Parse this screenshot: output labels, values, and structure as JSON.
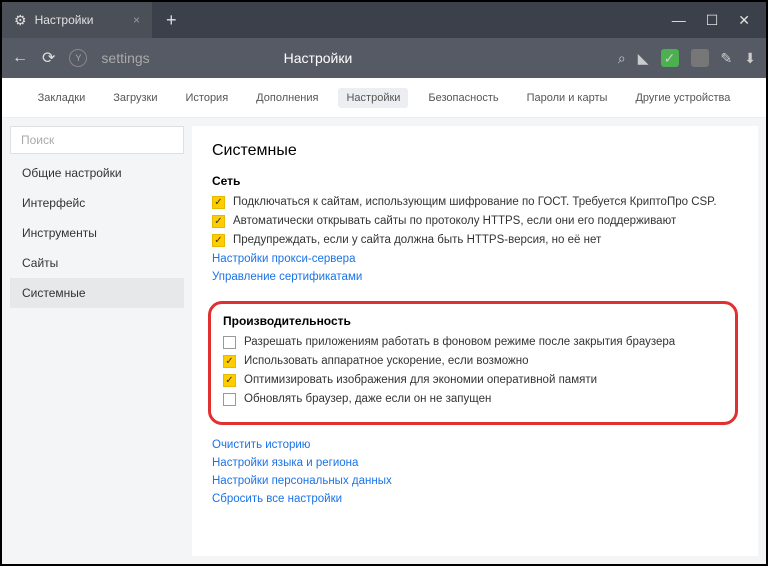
{
  "window": {
    "min": "—",
    "max": "☐",
    "close": "✕"
  },
  "tab": {
    "title": "Настройки",
    "close": "×",
    "new": "+"
  },
  "addr": {
    "back": "←",
    "reload": "⟳",
    "url": "settings",
    "title": "Настройки",
    "search": "⌕",
    "bookmark": "◣",
    "shield": "✓",
    "download": "⬇"
  },
  "topnav": {
    "items": [
      "Закладки",
      "Загрузки",
      "История",
      "Дополнения",
      "Настройки",
      "Безопасность",
      "Пароли и карты",
      "Другие устройства"
    ],
    "activeIndex": 4
  },
  "sidebar": {
    "search_placeholder": "Поиск",
    "items": [
      "Общие настройки",
      "Интерфейс",
      "Инструменты",
      "Сайты",
      "Системные"
    ],
    "activeIndex": 4
  },
  "main": {
    "heading": "Системные",
    "network": {
      "title": "Сеть",
      "rows": [
        {
          "checked": true,
          "label": "Подключаться к сайтам, использующим шифрование по ГОСТ. Требуется КриптоПро CSP."
        },
        {
          "checked": true,
          "label": "Автоматически открывать сайты по протоколу HTTPS, если они его поддерживают"
        },
        {
          "checked": true,
          "label": "Предупреждать, если у сайта должна быть HTTPS-версия, но её нет"
        }
      ],
      "links": [
        "Настройки прокси-сервера",
        "Управление сертификатами"
      ]
    },
    "performance": {
      "title": "Производительность",
      "rows": [
        {
          "checked": false,
          "label": "Разрешать приложениям работать в фоновом режиме после закрытия браузера"
        },
        {
          "checked": true,
          "label": "Использовать аппаратное ускорение, если возможно"
        },
        {
          "checked": true,
          "label": "Оптимизировать изображения для экономии оперативной памяти"
        },
        {
          "checked": false,
          "label": "Обновлять браузер, даже если он не запущен"
        }
      ]
    },
    "bottom_links": [
      "Очистить историю",
      "Настройки языка и региона",
      "Настройки персональных данных",
      "Сбросить все настройки"
    ]
  }
}
